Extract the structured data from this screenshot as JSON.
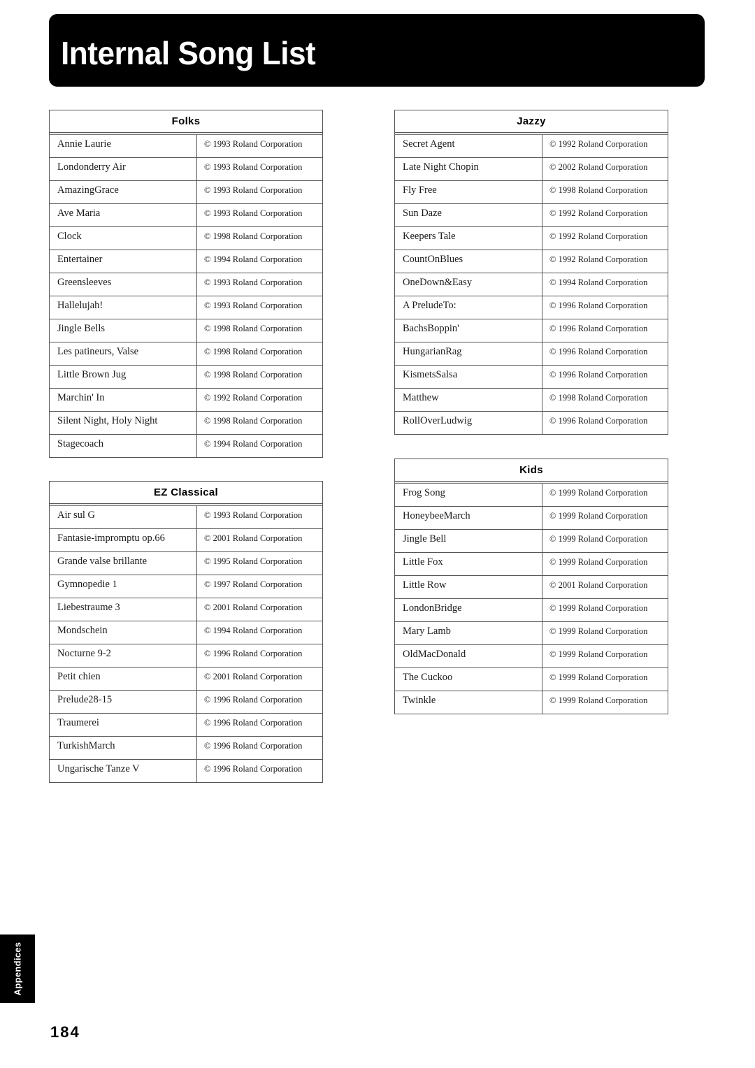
{
  "page": {
    "title": "Internal Song List",
    "side_tab": "Appendices",
    "page_number": "184"
  },
  "tables": {
    "folks": {
      "heading": "Folks",
      "rows": [
        {
          "name": "Annie Laurie",
          "copyright": "© 1993 Roland Corporation"
        },
        {
          "name": "Londonderry Air",
          "copyright": "© 1993 Roland Corporation"
        },
        {
          "name": "AmazingGrace",
          "copyright": "© 1993 Roland Corporation"
        },
        {
          "name": "Ave Maria",
          "copyright": "© 1993 Roland Corporation"
        },
        {
          "name": "Clock",
          "copyright": "© 1998 Roland Corporation"
        },
        {
          "name": "Entertainer",
          "copyright": "© 1994 Roland Corporation"
        },
        {
          "name": "Greensleeves",
          "copyright": "© 1993 Roland Corporation"
        },
        {
          "name": "Hallelujah!",
          "copyright": "© 1993 Roland Corporation"
        },
        {
          "name": "Jingle Bells",
          "copyright": "© 1998 Roland Corporation"
        },
        {
          "name": "Les patineurs, Valse",
          "copyright": "© 1998 Roland Corporation"
        },
        {
          "name": "Little Brown Jug",
          "copyright": "© 1998 Roland Corporation"
        },
        {
          "name": "Marchin' In",
          "copyright": "© 1992 Roland Corporation"
        },
        {
          "name": "Silent Night, Holy Night",
          "copyright": "© 1998 Roland Corporation"
        },
        {
          "name": "Stagecoach",
          "copyright": "© 1994 Roland Corporation"
        }
      ]
    },
    "ezclassical": {
      "heading": "EZ Classical",
      "rows": [
        {
          "name": "Air sul G",
          "copyright": "© 1993 Roland Corporation"
        },
        {
          "name": "Fantasie-impromptu op.66",
          "copyright": "© 2001 Roland Corporation"
        },
        {
          "name": "Grande valse brillante",
          "copyright": "© 1995 Roland Corporation"
        },
        {
          "name": "Gymnopedie 1",
          "copyright": "© 1997 Roland Corporation"
        },
        {
          "name": "Liebestraume 3",
          "copyright": "© 2001 Roland Corporation"
        },
        {
          "name": "Mondschein",
          "copyright": "© 1994 Roland Corporation"
        },
        {
          "name": "Nocturne 9-2",
          "copyright": "© 1996 Roland Corporation"
        },
        {
          "name": "Petit chien",
          "copyright": "© 2001 Roland Corporation"
        },
        {
          "name": "Prelude28-15",
          "copyright": "© 1996 Roland Corporation"
        },
        {
          "name": "Traumerei",
          "copyright": "© 1996 Roland Corporation"
        },
        {
          "name": "TurkishMarch",
          "copyright": "© 1996 Roland Corporation"
        },
        {
          "name": "Ungarische Tanze V",
          "copyright": "© 1996 Roland Corporation"
        }
      ]
    },
    "jazzy": {
      "heading": "Jazzy",
      "rows": [
        {
          "name": "Secret Agent",
          "copyright": "© 1992 Roland Corporation"
        },
        {
          "name": "Late Night Chopin",
          "copyright": "© 2002 Roland Corporation"
        },
        {
          "name": "Fly Free",
          "copyright": "© 1998 Roland Corporation"
        },
        {
          "name": "Sun Daze",
          "copyright": "© 1992 Roland Corporation"
        },
        {
          "name": "Keepers Tale",
          "copyright": "© 1992 Roland Corporation"
        },
        {
          "name": "CountOnBlues",
          "copyright": "© 1992 Roland Corporation"
        },
        {
          "name": "OneDown&Easy",
          "copyright": "© 1994 Roland Corporation"
        },
        {
          "name": "A PreludeTo:",
          "copyright": "© 1996 Roland Corporation"
        },
        {
          "name": "BachsBoppin'",
          "copyright": "© 1996 Roland Corporation"
        },
        {
          "name": "HungarianRag",
          "copyright": "© 1996 Roland Corporation"
        },
        {
          "name": "KismetsSalsa",
          "copyright": "© 1996 Roland Corporation"
        },
        {
          "name": "Matthew",
          "copyright": "© 1998 Roland Corporation"
        },
        {
          "name": "RollOverLudwig",
          "copyright": "© 1996 Roland Corporation"
        }
      ]
    },
    "kids": {
      "heading": "Kids",
      "rows": [
        {
          "name": "Frog Song",
          "copyright": "© 1999 Roland Corporation"
        },
        {
          "name": "HoneybeeMarch",
          "copyright": "© 1999 Roland Corporation"
        },
        {
          "name": "Jingle Bell",
          "copyright": "© 1999 Roland Corporation"
        },
        {
          "name": "Little Fox",
          "copyright": "© 1999 Roland Corporation"
        },
        {
          "name": "Little Row",
          "copyright": "© 2001 Roland Corporation"
        },
        {
          "name": "LondonBridge",
          "copyright": "© 1999 Roland Corporation"
        },
        {
          "name": "Mary Lamb",
          "copyright": "© 1999 Roland Corporation"
        },
        {
          "name": "OldMacDonald",
          "copyright": "© 1999 Roland Corporation"
        },
        {
          "name": "The Cuckoo",
          "copyright": "© 1999 Roland Corporation"
        },
        {
          "name": "Twinkle",
          "copyright": "© 1999 Roland Corporation"
        }
      ]
    }
  }
}
